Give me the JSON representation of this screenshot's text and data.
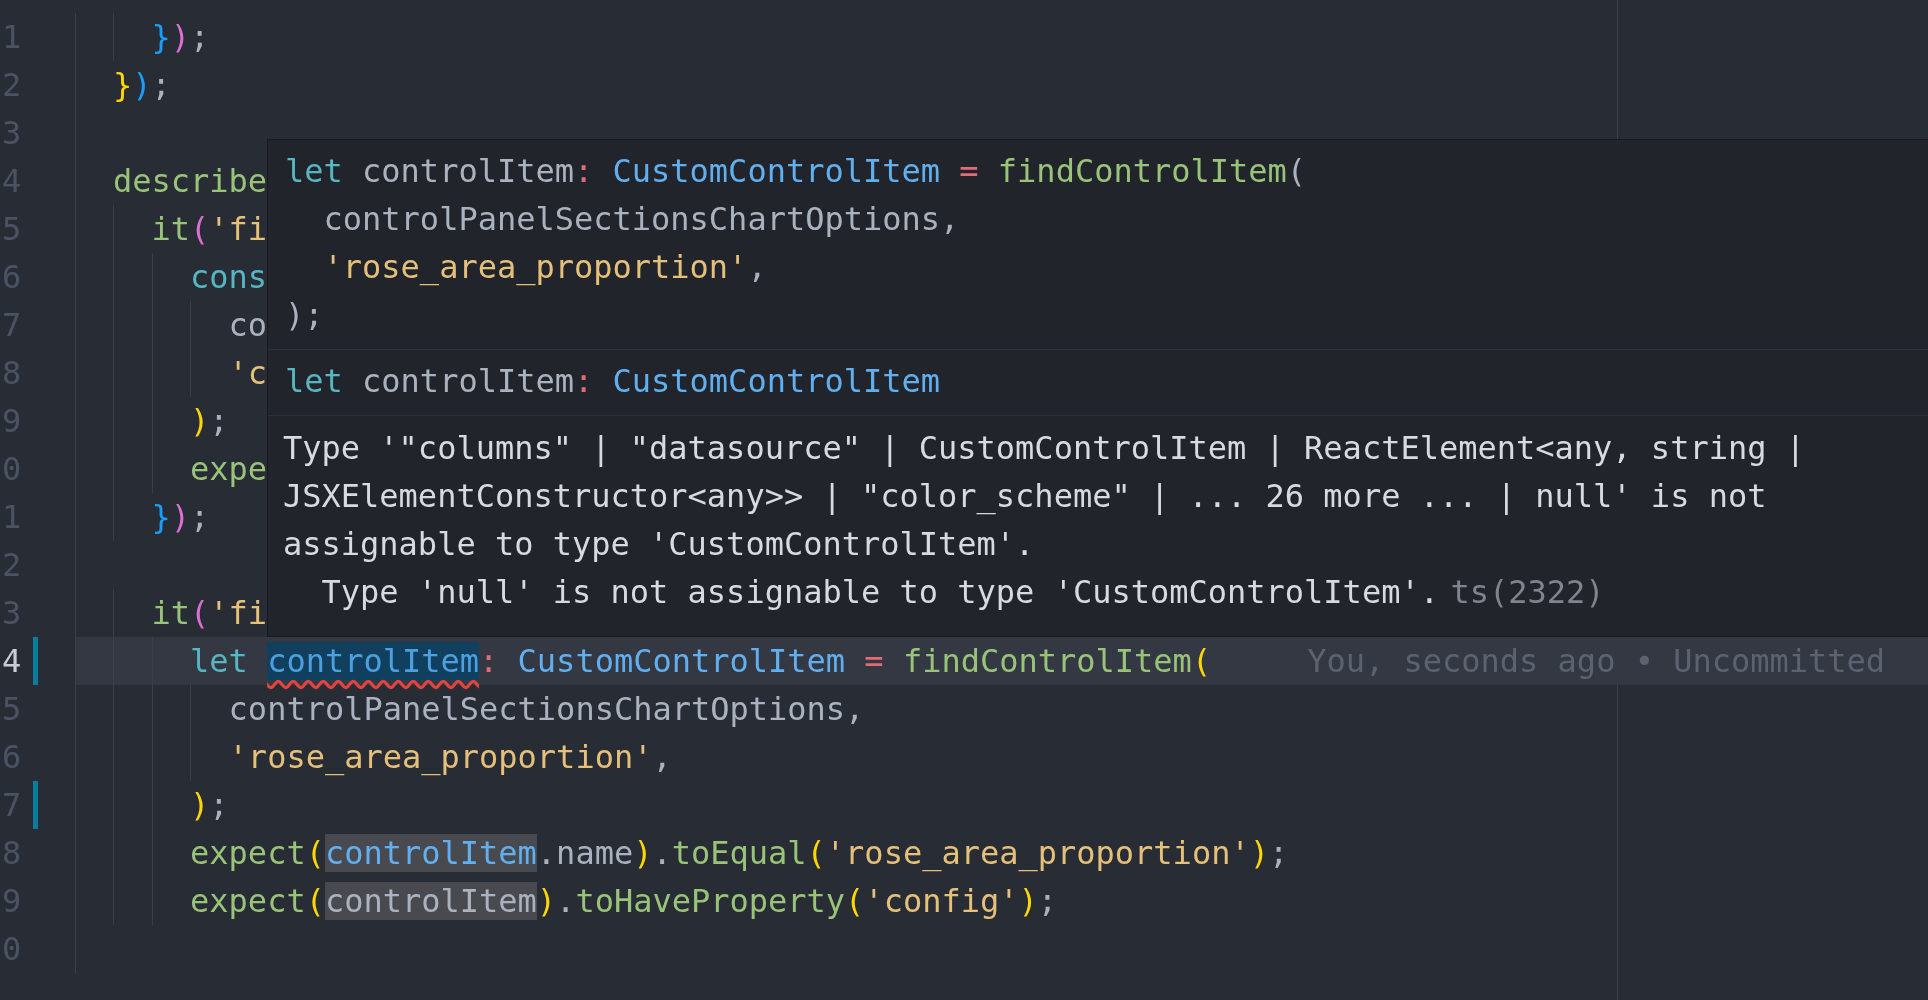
{
  "editor": {
    "lines": [
      {
        "number": "1",
        "current": false,
        "modified": false,
        "tokens": [
          {
            "text": "  }",
            "kind": "bracket-c"
          },
          {
            "text": ")",
            "kind": "bracket-b"
          },
          {
            "text": ";",
            "kind": "plain"
          }
        ]
      },
      {
        "number": "2",
        "current": false,
        "modified": false,
        "tokens": [
          {
            "text": "}",
            "kind": "bracket-a"
          },
          {
            "text": ")",
            "kind": "bracket-c"
          },
          {
            "text": ";",
            "kind": "plain"
          }
        ]
      },
      {
        "number": "3",
        "current": false,
        "modified": false
      },
      {
        "number": "4",
        "current": false,
        "modified": false,
        "tokens": [
          {
            "text": "describe",
            "kind": "function"
          }
        ]
      },
      {
        "number": "5",
        "current": false,
        "modified": false,
        "tokens": [
          {
            "text": "  it",
            "kind": "function"
          },
          {
            "text": "(",
            "kind": "bracket-b"
          },
          {
            "text": "'fi",
            "kind": "string"
          }
        ]
      },
      {
        "number": "6",
        "current": false,
        "modified": false,
        "tokens": [
          {
            "text": "    cons",
            "kind": "keyword"
          }
        ]
      },
      {
        "number": "7",
        "current": false,
        "modified": false,
        "tokens": [
          {
            "text": "      co",
            "kind": "plain"
          }
        ]
      },
      {
        "number": "8",
        "current": false,
        "modified": false,
        "tokens": [
          {
            "text": "      'c",
            "kind": "string"
          }
        ]
      },
      {
        "number": "9",
        "current": false,
        "modified": false,
        "tokens": [
          {
            "text": "    )",
            "kind": "bracket-a"
          },
          {
            "text": ";",
            "kind": "plain"
          }
        ]
      },
      {
        "number": "0",
        "current": false,
        "modified": false,
        "tokens": [
          {
            "text": "    expe",
            "kind": "function"
          }
        ]
      },
      {
        "number": "1",
        "current": false,
        "modified": false,
        "tokens": [
          {
            "text": "  }",
            "kind": "bracket-c"
          },
          {
            "text": ")",
            "kind": "bracket-b"
          },
          {
            "text": ";",
            "kind": "plain"
          }
        ]
      },
      {
        "number": "2",
        "current": false,
        "modified": false
      },
      {
        "number": "3",
        "current": false,
        "modified": false,
        "tokens": [
          {
            "text": "  it",
            "kind": "function"
          },
          {
            "text": "(",
            "kind": "bracket-b"
          },
          {
            "text": "'fi",
            "kind": "string"
          }
        ]
      },
      {
        "number": "4",
        "current": true,
        "modified": true,
        "blame": "You, seconds ago • Uncommitted",
        "tokens": [
          {
            "text": "    let ",
            "kind": "keyword"
          },
          {
            "text": "controlItem",
            "kind": "type",
            "error": true,
            "selected": true
          },
          {
            "text": ": ",
            "kind": "operator"
          },
          {
            "text": "CustomControlItem ",
            "kind": "type"
          },
          {
            "text": "= ",
            "kind": "operator"
          },
          {
            "text": "findControlItem",
            "kind": "function"
          },
          {
            "text": "(",
            "kind": "bracket-a"
          }
        ]
      },
      {
        "number": "5",
        "current": false,
        "modified": false,
        "tokens": [
          {
            "text": "      controlPanelSectionsChartOptions,",
            "kind": "plain"
          }
        ]
      },
      {
        "number": "6",
        "current": false,
        "modified": false,
        "tokens": [
          {
            "text": "      'rose_area_proportion'",
            "kind": "string"
          },
          {
            "text": ",",
            "kind": "plain"
          }
        ]
      },
      {
        "number": "7",
        "current": false,
        "modified": true,
        "tokens": [
          {
            "text": "    )",
            "kind": "bracket-a"
          },
          {
            "text": ";",
            "kind": "plain"
          }
        ]
      },
      {
        "number": "8",
        "current": false,
        "modified": false,
        "tokens": [
          {
            "text": "    expect",
            "kind": "function"
          },
          {
            "text": "(",
            "kind": "bracket-a"
          },
          {
            "text": "controlItem",
            "kind": "type",
            "highlighted": true
          },
          {
            "text": ".name",
            "kind": "plain"
          },
          {
            "text": ")",
            "kind": "bracket-a"
          },
          {
            "text": ".",
            "kind": "plain"
          },
          {
            "text": "toEqual",
            "kind": "function"
          },
          {
            "text": "(",
            "kind": "bracket-a"
          },
          {
            "text": "'rose_area_proportion'",
            "kind": "string"
          },
          {
            "text": ")",
            "kind": "bracket-a"
          },
          {
            "text": ";",
            "kind": "plain"
          }
        ]
      },
      {
        "number": "9",
        "current": false,
        "modified": false,
        "tokens": [
          {
            "text": "    expect",
            "kind": "function"
          },
          {
            "text": "(",
            "kind": "bracket-a"
          },
          {
            "text": "controlItem",
            "kind": "plain",
            "highlighted": true
          },
          {
            "text": ")",
            "kind": "bracket-a"
          },
          {
            "text": ".",
            "kind": "plain"
          },
          {
            "text": "toHaveProperty",
            "kind": "function"
          },
          {
            "text": "(",
            "kind": "bracket-a"
          },
          {
            "text": "'config'",
            "kind": "string"
          },
          {
            "text": ")",
            "kind": "bracket-a"
          },
          {
            "text": ";",
            "kind": "plain"
          }
        ]
      },
      {
        "number": "0",
        "current": false,
        "modified": false
      }
    ]
  },
  "tooltip": {
    "preview": [
      {
        "tokens": [
          {
            "text": "let",
            "kind": "keyword"
          },
          {
            "text": " controlItem",
            "kind": "plain"
          },
          {
            "text": ": ",
            "kind": "operator"
          },
          {
            "text": "CustomControlItem ",
            "kind": "type"
          },
          {
            "text": "= ",
            "kind": "operator"
          },
          {
            "text": "findControlItem",
            "kind": "function"
          },
          {
            "text": "(",
            "kind": "plain"
          }
        ]
      },
      {
        "tokens": [
          {
            "text": "  controlPanelSectionsChartOptions,",
            "kind": "plain"
          }
        ]
      },
      {
        "tokens": [
          {
            "text": "  'rose_area_proportion'",
            "kind": "string"
          },
          {
            "text": ",",
            "kind": "plain"
          }
        ]
      },
      {
        "tokens": [
          {
            "text": ");",
            "kind": "plain"
          }
        ]
      }
    ],
    "signature": {
      "tokens": [
        {
          "text": "let",
          "kind": "keyword"
        },
        {
          "text": " controlItem",
          "kind": "plain"
        },
        {
          "text": ": ",
          "kind": "operator"
        },
        {
          "text": "CustomControlItem",
          "kind": "type"
        }
      ]
    },
    "message": "Type '\"columns\" | \"datasource\" | CustomControlItem | ReactElement<any, string | JSXElementConstructor<any>> | \"color_scheme\" | ... 26 more ... | null' is not assignable to type 'CustomControlItem'.",
    "detail": "Type 'null' is not assignable to type 'CustomControlItem'.",
    "code": "ts(2322)"
  }
}
